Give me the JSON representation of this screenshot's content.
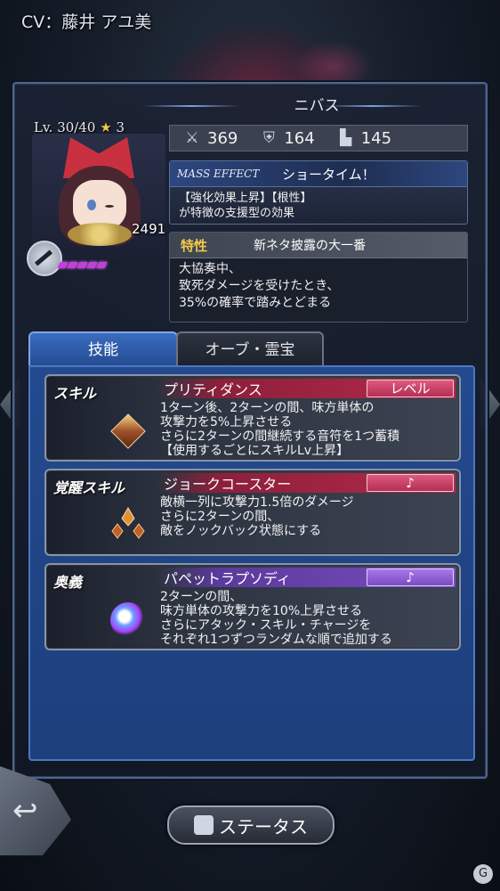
{
  "header": {
    "cv_text": "CV：藤井 アユ美"
  },
  "character": {
    "name": "ニバス",
    "level_text": "Lv. 30/40",
    "stars": "3",
    "power": "2491"
  },
  "stats": [
    {
      "icon": "sword-icon",
      "value": "369"
    },
    {
      "icon": "shield-icon",
      "value": "164"
    },
    {
      "icon": "boot-icon",
      "value": "145"
    }
  ],
  "mass_effect": {
    "tag": "MASS EFFECT",
    "title": "ショータイム！",
    "desc_line1": "【強化効果上昇】【根性】",
    "desc_line2": "が特徴の支援型の効果"
  },
  "trait": {
    "label": "特性",
    "title": "新ネタ披露の大一番",
    "desc_line1": "大協奏中、",
    "desc_line2": "致死ダメージを受けたとき、",
    "desc_line3": "35%の確率で踏みとどまる"
  },
  "tabs": [
    {
      "label": "技能",
      "active": true
    },
    {
      "label": "オーブ・霊宝",
      "active": false
    }
  ],
  "skills": [
    {
      "type": "スキル",
      "name": "プリティダンス",
      "badge": "レベル",
      "desc": [
        "1ターン後、2ターンの間、味方単体の",
        "攻撃力を5%上昇させる",
        "さらに2ターンの間継続する音符を1つ蓄積",
        "【使用するごとにスキルLv上昇】"
      ]
    },
    {
      "type": "覚醒スキル",
      "name": "ジョークコースター",
      "badge": "♪",
      "desc": [
        "敵横一列に攻撃力1.5倍のダメージ",
        "さらに2ターンの間、",
        "敵をノックバック状態にする"
      ]
    },
    {
      "type": "奥義",
      "name": "パペットラプソディ",
      "badge": "♪",
      "desc": [
        "2ターンの間、",
        "味方単体の攻撃力を10%上昇させる",
        "さらにアタック・スキル・チャージを",
        "それぞれ1つずつランダムな順で追加する"
      ]
    }
  ],
  "buttons": {
    "status": "ステータス"
  }
}
